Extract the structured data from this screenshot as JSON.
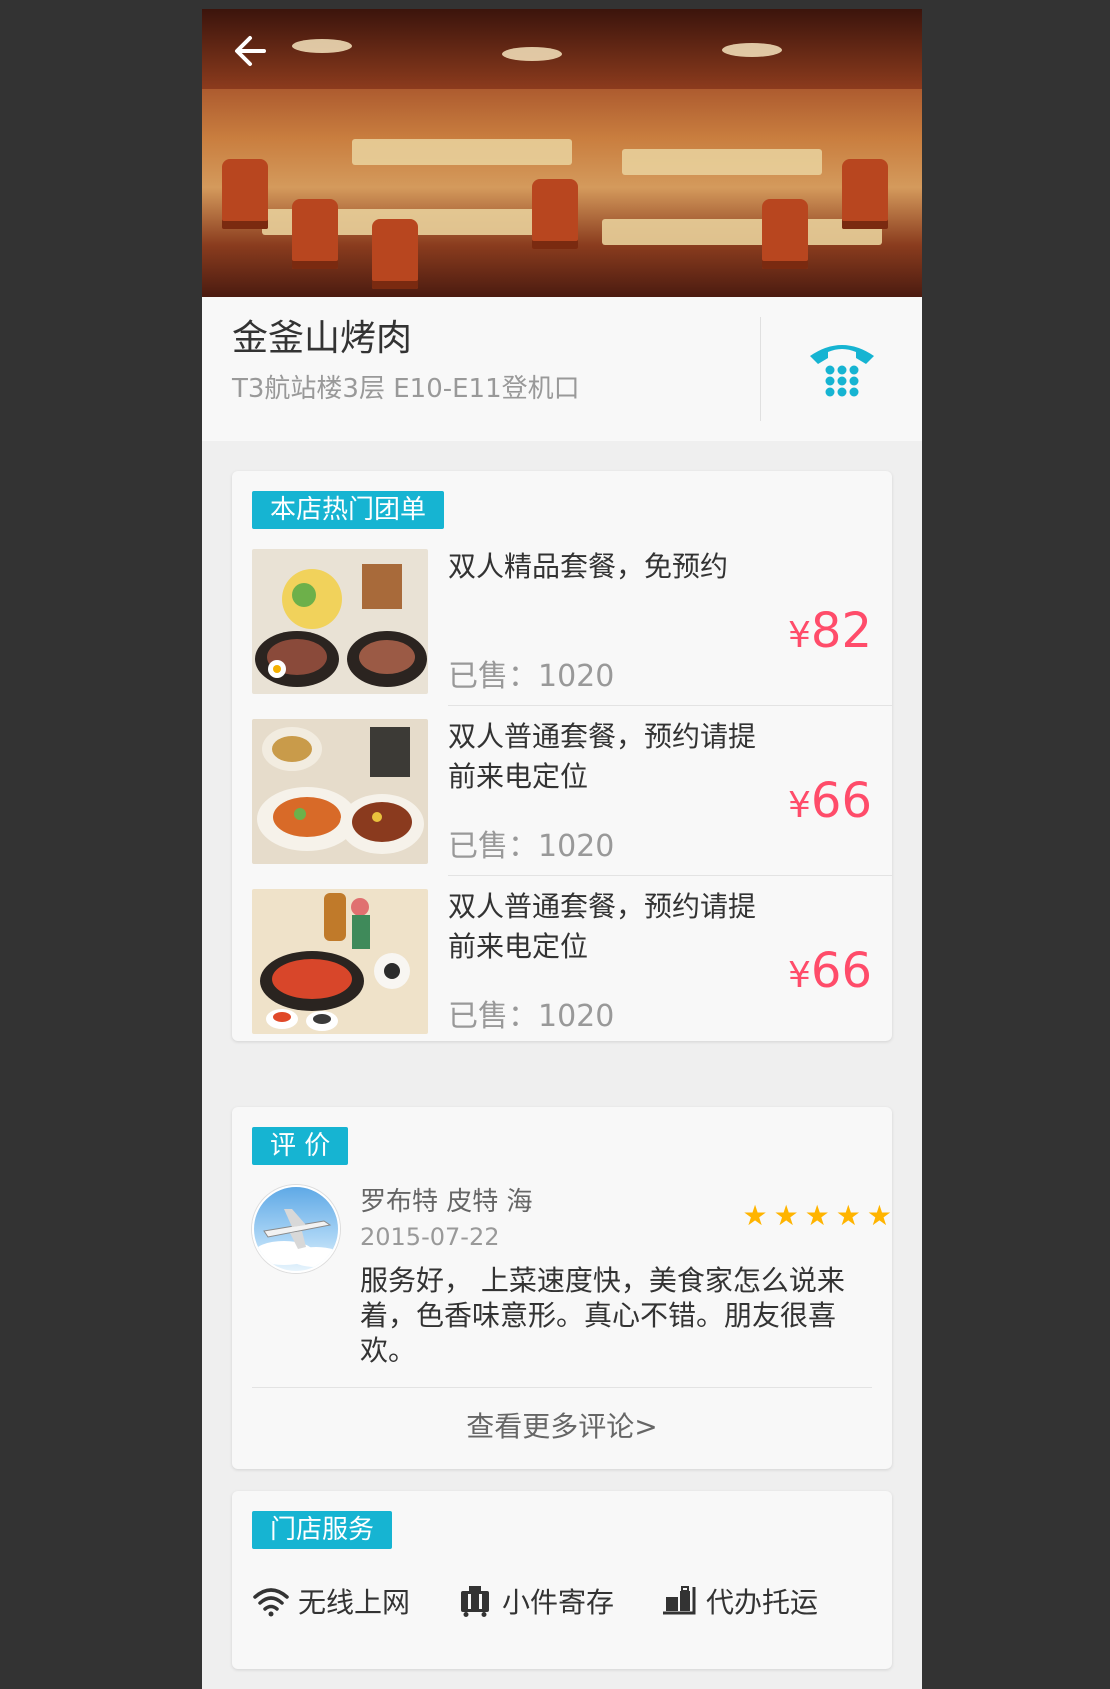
{
  "header": {
    "back_icon": "arrow-left-icon"
  },
  "shop": {
    "name": "金釜山烤肉",
    "address": "T3航站楼3层  E10-E11登机口",
    "phone_icon": "telephone-icon"
  },
  "deals_section": {
    "tag": "本店热门团单",
    "items": [
      {
        "title": "双人精品套餐，免预约",
        "sold": "已售：1020",
        "currency": "¥",
        "price": "82"
      },
      {
        "title": "双人普通套餐，预约请提前来电定位",
        "sold": "已售：1020",
        "currency": "¥",
        "price": "66"
      },
      {
        "title": "双人普通套餐，预约请提前来电定位",
        "sold": "已售：1020",
        "currency": "¥",
        "price": "66"
      }
    ]
  },
  "review_section": {
    "tag": "评 价",
    "reviewer": "罗布特 皮特 海",
    "date": "2015-07-22",
    "rating": 5,
    "text": "服务好， 上菜速度快，美食家怎么说来着，色香味意形。真心不错。朋友很喜欢。",
    "more": "查看更多评论>"
  },
  "service_section": {
    "tag": "门店服务",
    "items": [
      {
        "label": "无线上网",
        "icon": "wifi-icon"
      },
      {
        "label": "小件寄存",
        "icon": "luggage-icon"
      },
      {
        "label": "代办托运",
        "icon": "baggage-cart-icon"
      }
    ]
  },
  "colors": {
    "accent": "#16b4d2",
    "price": "#ff4c6a",
    "star": "#ffb400",
    "primary_text": "#333333",
    "secondary_text": "#999999"
  }
}
